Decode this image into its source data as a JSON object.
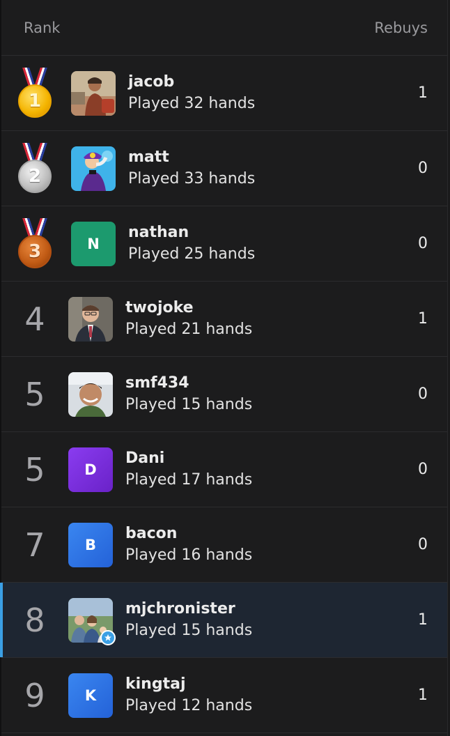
{
  "header": {
    "rank_label": "Rank",
    "rebuys_label": "Rebuys"
  },
  "players": [
    {
      "rank": "1",
      "medal": "gold",
      "name": "jacob",
      "hands": "Played 32 hands",
      "rebuys": "1",
      "avatar": {
        "type": "photo",
        "desc": "jacob-photo"
      }
    },
    {
      "rank": "2",
      "medal": "silver",
      "name": "matt",
      "hands": "Played 33 hands",
      "rebuys": "0",
      "avatar": {
        "type": "photo",
        "desc": "matt-photo"
      }
    },
    {
      "rank": "3",
      "medal": "bronze",
      "name": "nathan",
      "hands": "Played 25 hands",
      "rebuys": "0",
      "avatar": {
        "type": "initial",
        "initial": "N",
        "color": "#1c9a6e"
      }
    },
    {
      "rank": "4",
      "name": "twojoke",
      "hands": "Played 21 hands",
      "rebuys": "1",
      "avatar": {
        "type": "photo",
        "desc": "twojoke-photo"
      }
    },
    {
      "rank": "5",
      "name": "smf434",
      "hands": "Played 15 hands",
      "rebuys": "0",
      "avatar": {
        "type": "photo",
        "desc": "smf434-photo"
      }
    },
    {
      "rank": "5",
      "name": "Dani",
      "hands": "Played 17 hands",
      "rebuys": "0",
      "avatar": {
        "type": "initial",
        "initial": "D",
        "color": "#7a2fe0"
      }
    },
    {
      "rank": "7",
      "name": "bacon",
      "hands": "Played 16 hands",
      "rebuys": "0",
      "avatar": {
        "type": "initial",
        "initial": "B",
        "color": "#2f73e8"
      }
    },
    {
      "rank": "8",
      "name": "mjchronister",
      "hands": "Played 15 hands",
      "rebuys": "1",
      "highlighted": true,
      "avatar": {
        "type": "photo",
        "desc": "mjchronister-photo",
        "badge": "star-badge-icon"
      }
    },
    {
      "rank": "9",
      "name": "kingtaj",
      "hands": "Played 12 hands",
      "rebuys": "1",
      "avatar": {
        "type": "initial",
        "initial": "K",
        "color": "#2f73e8"
      }
    }
  ],
  "colors": {
    "background": "#1c1c1d",
    "highlight_row": "#1e2632",
    "highlight_accent": "#3b9fe5",
    "gold": "#f4b400",
    "silver": "#bdbdbd",
    "bronze": "#c05a14"
  }
}
